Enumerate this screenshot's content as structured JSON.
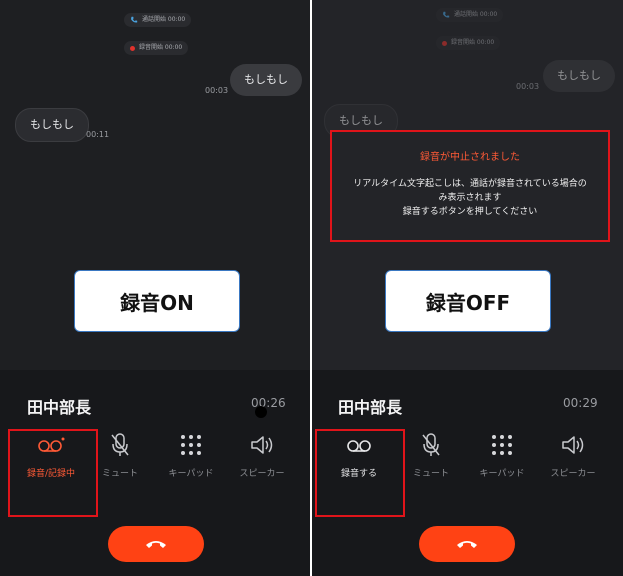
{
  "left": {
    "sys1": "通話開始 00:00",
    "sys2": "録音開始 00:00",
    "msg_sent": "もしもし",
    "msg_sent_time": "00:03",
    "msg_recv": "もしもし",
    "msg_recv_time": "00:11",
    "state_label": "録音ON",
    "caller": "田中部長",
    "timer": "00:26",
    "controls": {
      "record": "録音/記録中",
      "mute": "ミュート",
      "keypad": "キーパッド",
      "speaker": "スピーカー"
    }
  },
  "right": {
    "sys1": "通話開始 00:00",
    "sys2": "録音開始 00:00",
    "msg_sent": "もしもし",
    "msg_sent_time": "00:03",
    "msg_recv": "もしもし",
    "alert": {
      "title": "録音が中止されました",
      "line1": "リアルタイム文字起こしは、通話が録音されている場合の",
      "line2": "み表示されます",
      "line3": "録音するボタンを押してください"
    },
    "state_label": "録音OFF",
    "caller": "田中部長",
    "timer": "00:29",
    "controls": {
      "record": "録音する",
      "mute": "ミュート",
      "keypad": "キーパッド",
      "speaker": "スピーカー"
    }
  },
  "colors": {
    "accent": "#ff4214",
    "highlight_border": "#e0141a",
    "background": "#1e1f22"
  },
  "icons": [
    "phone-icon",
    "voicemail-icon",
    "microphone-off-icon",
    "keypad-icon",
    "speaker-icon",
    "hang-up-icon"
  ]
}
